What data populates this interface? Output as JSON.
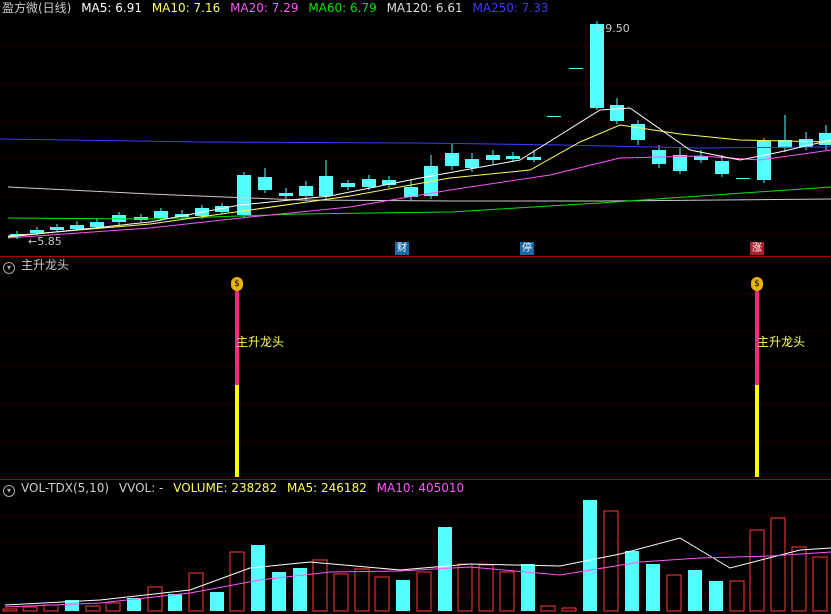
{
  "main_header": {
    "title": "盈方微(日线)",
    "ma5": "MA5: 6.91",
    "ma10": "MA10: 7.16",
    "ma20": "MA20: 7.29",
    "ma60": "MA60: 6.79",
    "ma120": "MA120: 6.61",
    "ma250": "MA250: 7.33"
  },
  "main_labels": {
    "high": "9.50",
    "low": "5.85"
  },
  "events": [
    {
      "label": "财",
      "color": "#1a6aa6"
    },
    {
      "label": "停",
      "color": "#1a6aa6"
    },
    {
      "label": "涨",
      "color": "#b0202a"
    }
  ],
  "signal_header": {
    "title": "主升龙头"
  },
  "signal_markers": [
    {
      "label": "主升龙头"
    },
    {
      "label": "主升龙头"
    }
  ],
  "volume_header": {
    "title": "VOL-TDX(5,10)",
    "vvol": "VVOL: -",
    "volume": "VOLUME: 238282",
    "ma5": "MA5: 246182",
    "ma10": "MA10: 405010"
  },
  "colors": {
    "up": "#ff3b3b",
    "down": "#54ffff",
    "ma5": "#ffffff",
    "ma10": "#ffff54",
    "ma20": "#ff54ff",
    "ma60": "#00e600",
    "ma120": "#cccccc",
    "ma250": "#3c3cff",
    "signal_upper": "#e8307a",
    "signal_lower": "#ffff00"
  }
}
